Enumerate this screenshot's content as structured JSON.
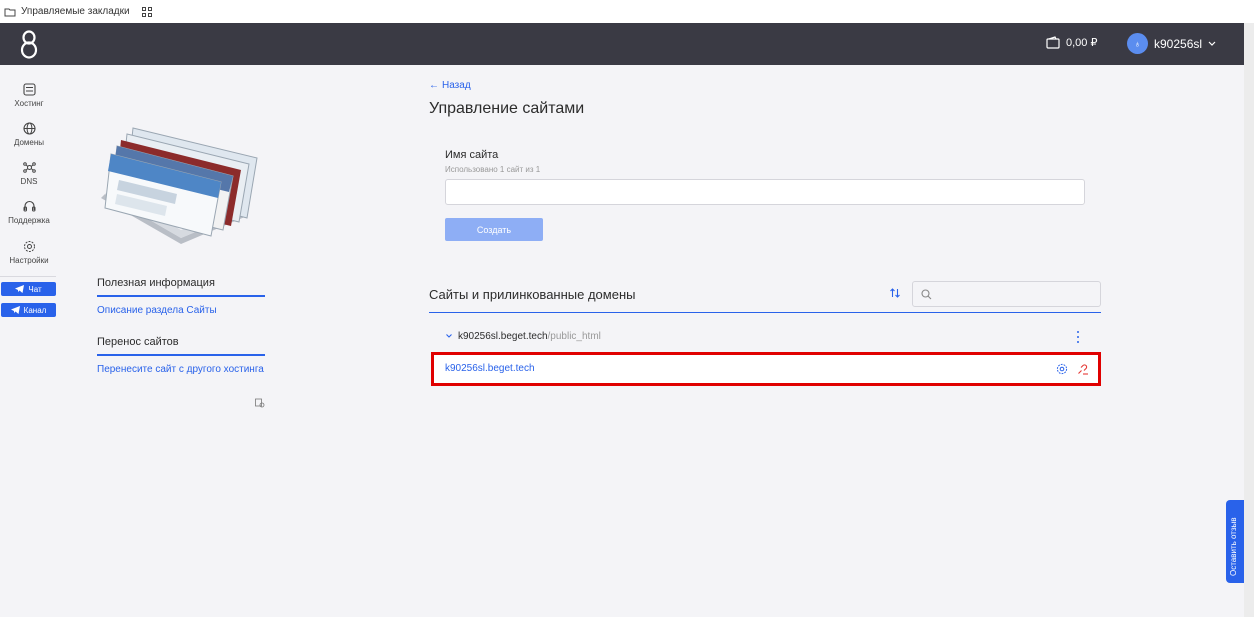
{
  "bookmarks_bar": {
    "label": "Управляемые закладки"
  },
  "header": {
    "balance": "0,00 ₽",
    "username": "k90256sl",
    "avatar_glyph": "♁",
    "logo_glyph": "8"
  },
  "sidebar": {
    "items": [
      {
        "label": "Хостинг",
        "icon": "hosting-icon"
      },
      {
        "label": "Домены",
        "icon": "globe-icon"
      },
      {
        "label": "DNS",
        "icon": "dns-icon"
      },
      {
        "label": "Поддержка",
        "icon": "support-icon"
      },
      {
        "label": "Настройки",
        "icon": "gear-icon"
      }
    ],
    "chat_button": "Чат",
    "channel_button": "Канал"
  },
  "info": {
    "useful_title": "Полезная информация",
    "useful_link": "Описание раздела Сайты",
    "transfer_title": "Перенос сайтов",
    "transfer_link": "Перенесите сайт с другого хостинга"
  },
  "main": {
    "back_link": "Назад",
    "title": "Управление сайтами",
    "form": {
      "label": "Имя сайта",
      "hint": "Использовано 1 сайт из 1",
      "value": "",
      "create_button": "Создать"
    },
    "sites_section": {
      "title": "Сайты и прилинкованные домены",
      "search_value": "",
      "group_name": "k90256sl.beget.tech",
      "group_path": "/public_html",
      "domain": "k90256sl.beget.tech"
    }
  },
  "feedback_tab": "Оставить отзыв",
  "colors": {
    "accent": "#2962ea",
    "topbar": "#3a3a44",
    "highlight": "#e00000",
    "button_disabled": "#8eaef5"
  }
}
